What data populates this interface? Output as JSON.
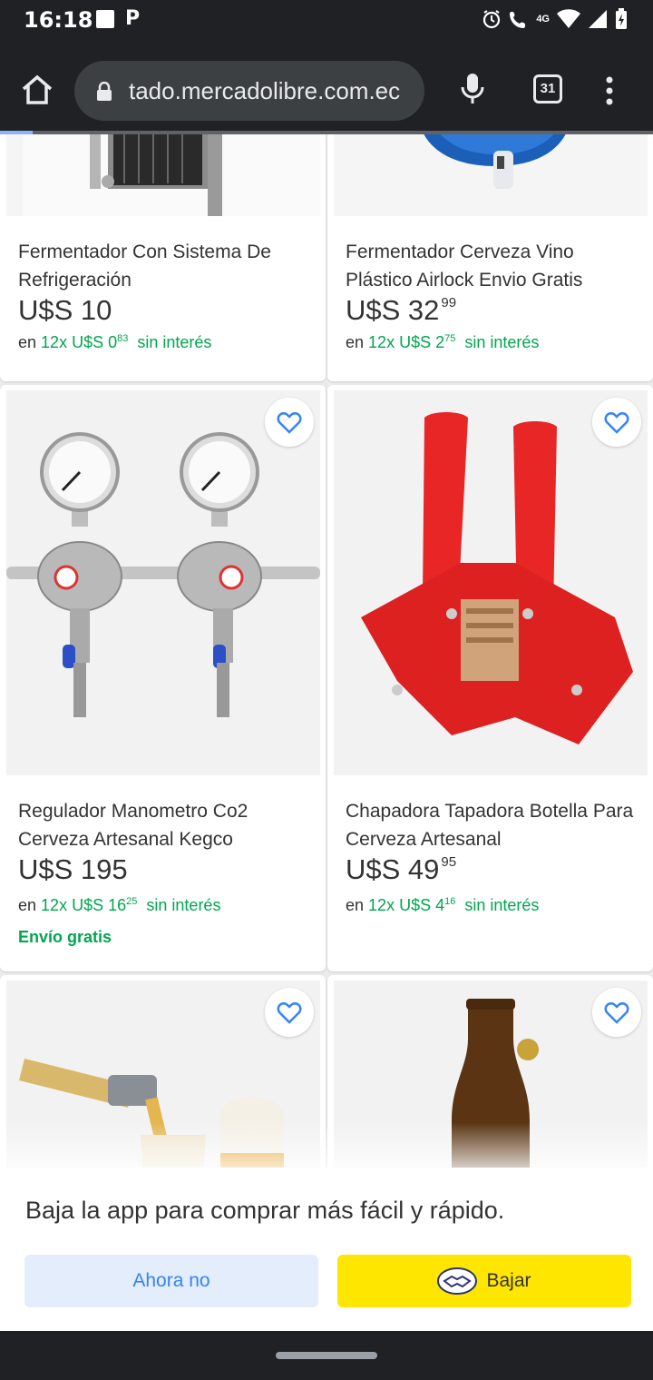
{
  "status": {
    "time": "16:18",
    "network": "4G"
  },
  "browser": {
    "url": "tado.mercadolibre.com.ec",
    "tab_count": "31"
  },
  "products": [
    {
      "title": "Fermentador Con Sistema De Refrigeración",
      "price_int": "U$S 10",
      "price_cents": "",
      "inst_pre": "en",
      "inst_count": "12x",
      "inst_amount": "U$S 0",
      "inst_cents": "83",
      "inst_suffix": "sin interés",
      "shipping": ""
    },
    {
      "title": "Fermentador Cerveza Vino Plástico Airlock Envio Gratis",
      "price_int": "U$S 32",
      "price_cents": "99",
      "inst_pre": "en",
      "inst_count": "12x",
      "inst_amount": "U$S 2",
      "inst_cents": "75",
      "inst_suffix": "sin interés",
      "shipping": ""
    },
    {
      "title": "Regulador Manometro Co2 Cerveza Artesanal Kegco",
      "price_int": "U$S 195",
      "price_cents": "",
      "inst_pre": "en",
      "inst_count": "12x",
      "inst_amount": "U$S 16",
      "inst_cents": "25",
      "inst_suffix": "sin interés",
      "shipping": "Envío gratis"
    },
    {
      "title": "Chapadora Tapadora Botella Para Cerveza Artesanal",
      "price_int": "U$S 49",
      "price_cents": "95",
      "inst_pre": "en",
      "inst_count": "12x",
      "inst_amount": "U$S 4",
      "inst_cents": "16",
      "inst_suffix": "sin interés",
      "shipping": ""
    }
  ],
  "banner": {
    "text": "Baja la app para comprar más fácil y rápido.",
    "dismiss_label": "Ahora no",
    "download_label": "Bajar"
  },
  "colors": {
    "accent_blue": "#3483fa",
    "green": "#00a650",
    "yellow": "#ffe600"
  },
  "icons": [
    "home-icon",
    "lock-icon",
    "mic-icon",
    "tabs-icon",
    "menu-icon",
    "heart-icon",
    "handshake-icon"
  ]
}
